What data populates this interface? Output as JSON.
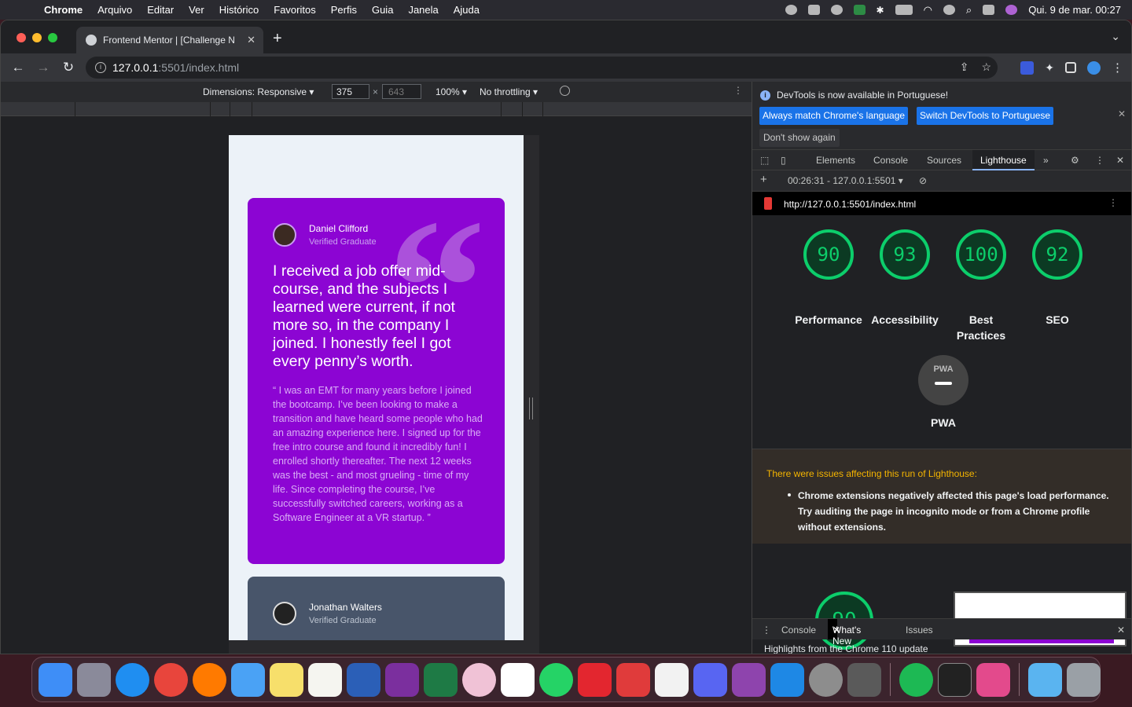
{
  "menubar": {
    "app": "Chrome",
    "items": [
      "Arquivo",
      "Editar",
      "Ver",
      "Histórico",
      "Favoritos",
      "Perfis",
      "Guia",
      "Janela",
      "Ajuda"
    ],
    "datetime": "Qui. 9 de mar.  00:27"
  },
  "browser": {
    "tab_title": "Frontend Mentor | [Challenge N",
    "url_host": "127.0.0.1",
    "url_rest": ":5501/index.html"
  },
  "device_toolbar": {
    "dimensions": "Dimensions: Responsive ▾",
    "width": "375",
    "height": "643",
    "zoom": "100% ▾",
    "throttling": "No throttling ▾"
  },
  "page": {
    "card1": {
      "name": "Daniel Clifford",
      "role": "Verified Graduate",
      "headline": "I received a job offer mid-course, and the subjects I learned were current, if not more so, in the company I joined. I honestly feel I got every penny’s worth.",
      "quote": "“ I was an EMT for many years before I joined the bootcamp. I’ve been looking to make a transition and have heard some people who had an amazing experience here. I signed up for the free intro course and found it incredibly fun! I enrolled shortly thereafter. The next 12 weeks was the best - and most grueling - time of my life. Since completing the course, I’ve successfully switched careers, working as a Software Engineer at a VR startup. ”"
    },
    "card2": {
      "name": "Jonathan Walters",
      "role": "Verified Graduate"
    }
  },
  "devtools": {
    "notice": "DevTools is now available in Portuguese!",
    "btn_match": "Always match Chrome's language",
    "btn_switch": "Switch DevTools to Portuguese",
    "btn_dont": "Don't show again",
    "tabs": [
      "Elements",
      "Console",
      "Sources",
      "Lighthouse"
    ],
    "active_tab": "Lighthouse",
    "report_select": "00:26:31 - 127.0.0.1:5501 ▾",
    "report_url": "http://127.0.0.1:5501/index.html",
    "scores": [
      {
        "label": "Performance",
        "value": "90"
      },
      {
        "label": "Accessibility",
        "value": "93"
      },
      {
        "label": "Best Practices",
        "value": "100"
      },
      {
        "label": "SEO",
        "value": "92"
      }
    ],
    "pwa_label": "PWA",
    "pwa_badge": "PWA",
    "issues_head": "There were issues affecting this run of Lighthouse:",
    "issues_body": "Chrome extensions negatively affected this page's load performance. Try auditing the page in incognito mode or from a Chrome profile without extensions.",
    "perf_score": "90",
    "drawer_tabs": [
      "Console",
      "What's New",
      "Issues"
    ],
    "drawer_active": "What's New",
    "drawer_text": "Highlights from the Chrome 110 update"
  },
  "colors": {
    "score_green": "#0cce6b",
    "card_purple": "#8c05d3",
    "card_slate": "#48556a"
  }
}
